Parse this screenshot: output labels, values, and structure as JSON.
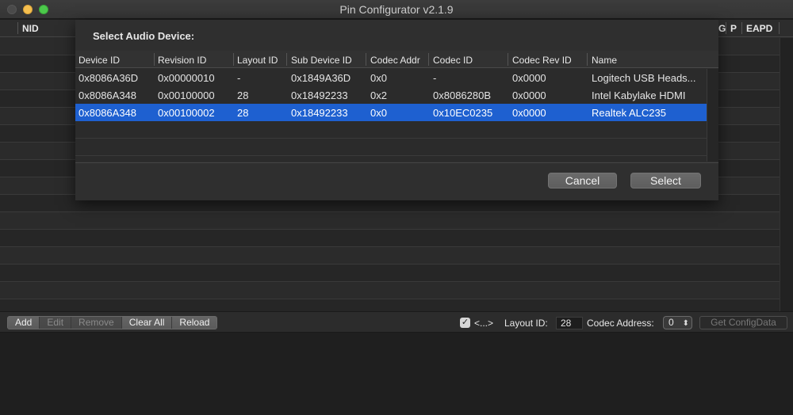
{
  "window": {
    "title": "Pin Configurator v2.1.9"
  },
  "bg_table": {
    "headers": {
      "nid": "NID",
      "g": "G",
      "p": "P",
      "eapd": "EAPD"
    }
  },
  "dialog": {
    "title": "Select Audio Device:",
    "columns": [
      "Device ID",
      "Revision ID",
      "Layout ID",
      "Sub Device ID",
      "Codec Addr",
      "Codec ID",
      "Codec Rev ID",
      "Name"
    ],
    "rows": [
      [
        "0x8086A36D",
        "0x00000010",
        "-",
        "0x1849A36D",
        "0x0",
        "-",
        "0x0000",
        "Logitech USB Heads..."
      ],
      [
        "0x8086A348",
        "0x00100000",
        "28",
        "0x18492233",
        "0x2",
        "0x8086280B",
        "0x0000",
        "Intel Kabylake HDMI"
      ],
      [
        "0x8086A348",
        "0x00100002",
        "28",
        "0x18492233",
        "0x0",
        "0x10EC0235",
        "0x0000",
        "Realtek ALC235"
      ]
    ],
    "selected_row": 2,
    "cancel_label": "Cancel",
    "select_label": "Select"
  },
  "toolbar": {
    "add_label": "Add",
    "edit_label": "Edit",
    "remove_label": "Remove",
    "clear_all_label": "Clear All",
    "reload_label": "Reload",
    "checkbox_checked": true,
    "checkbox_label": "<...>",
    "layout_id_label": "Layout ID:",
    "layout_id_value": "28",
    "codec_address_label": "Codec Address:",
    "codec_address_value": "0",
    "get_config_label": "Get ConfigData"
  },
  "colors": {
    "selection": "#1e60d0",
    "minimize": "#f5bf4f",
    "maximize": "#4cc94b"
  }
}
